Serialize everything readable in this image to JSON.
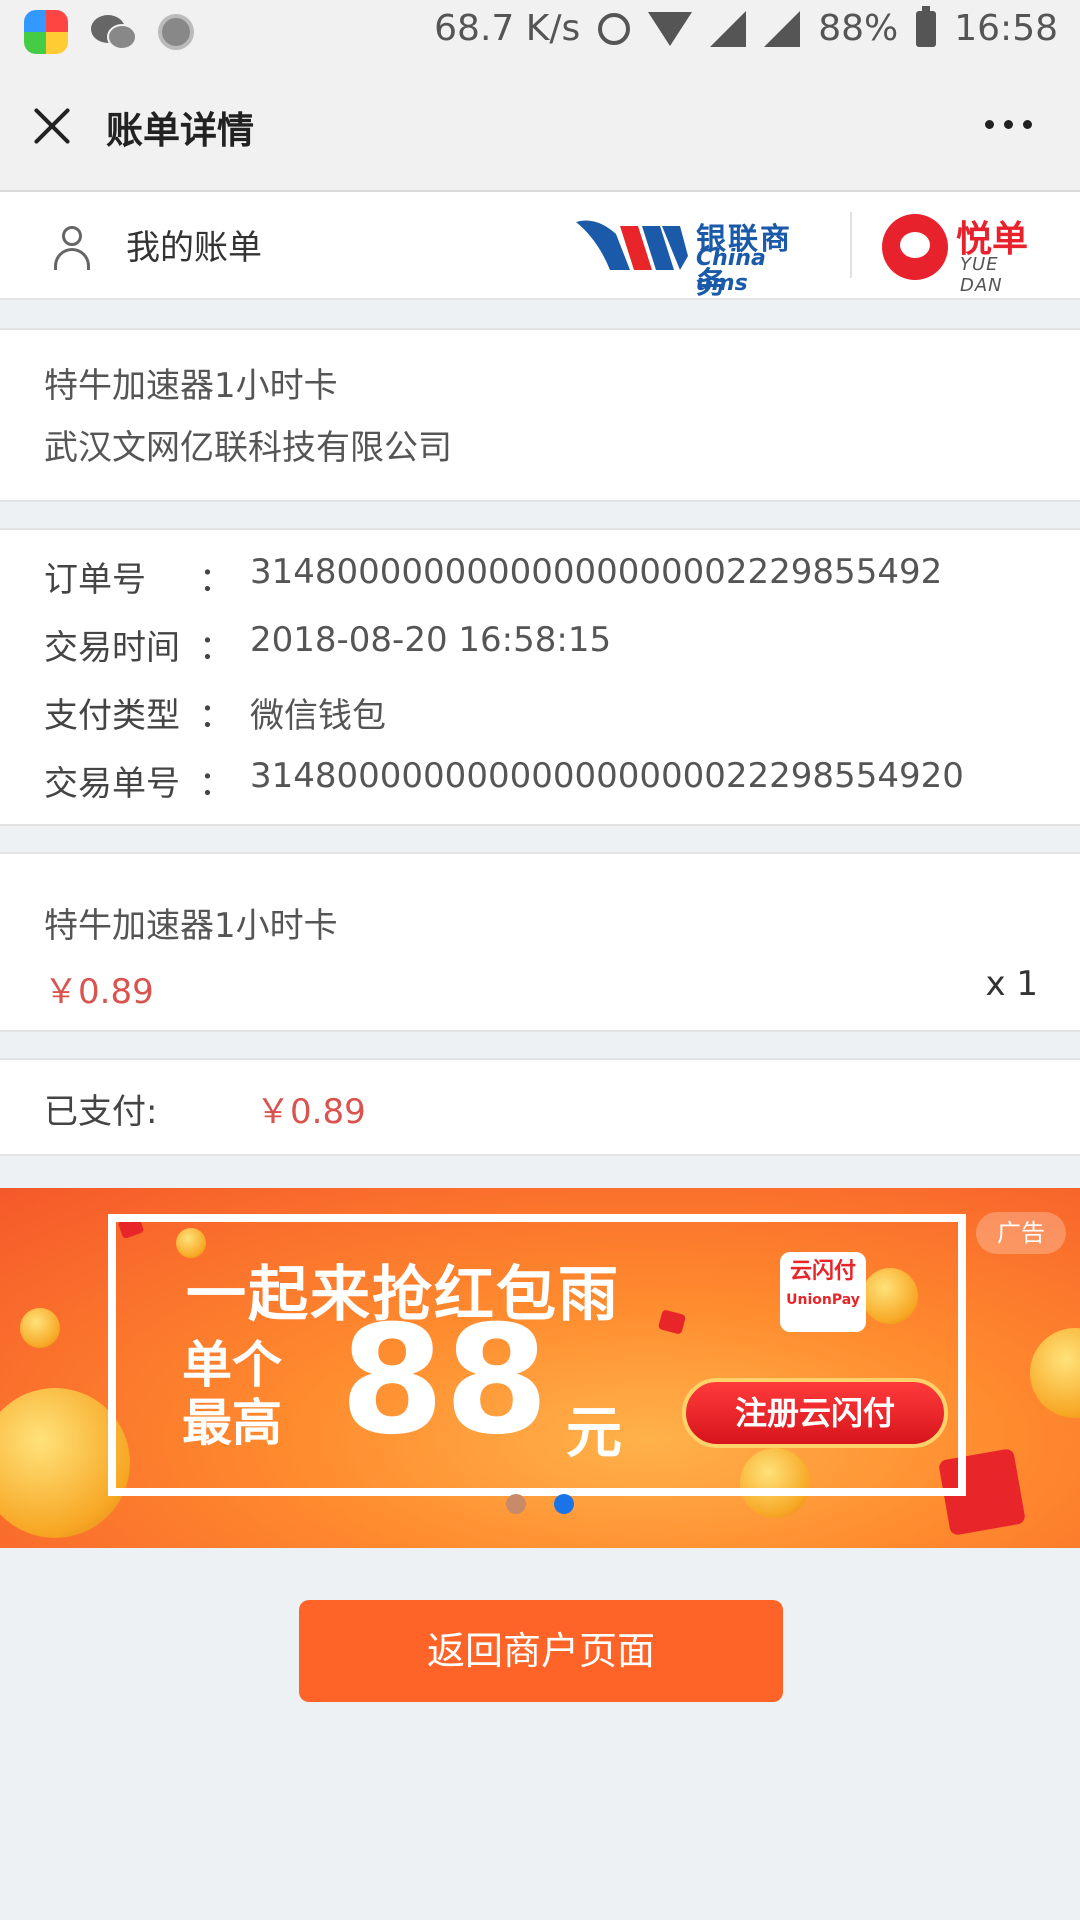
{
  "status_bar": {
    "speed": "68.7 K/s",
    "battery": "88%",
    "time": "16:58"
  },
  "nav": {
    "title": "账单详情"
  },
  "header": {
    "my_bill": "我的账单",
    "chinaums_cn": "银联商务",
    "chinaums_en": "China ums",
    "yuedan_cn": "悦单",
    "yuedan_en": "YUE DAN"
  },
  "merchant": {
    "product": "特牛加速器1小时卡",
    "company": "武汉文网亿联科技有限公司"
  },
  "order": {
    "rows": [
      {
        "label": "订单号",
        "value": "31480000000000000000002229855492"
      },
      {
        "label": "交易时间",
        "value": "2018-08-20 16:58:15"
      },
      {
        "label": "支付类型",
        "value": "微信钱包"
      },
      {
        "label": "交易单号",
        "value": "314800000000000000000022298554920"
      }
    ],
    "colon": "："
  },
  "item": {
    "name": "特牛加速器1小时卡",
    "price": "￥0.89",
    "qty": "x 1"
  },
  "paid": {
    "label": "已支付:",
    "amount": "￥0.89"
  },
  "banner": {
    "ad_tag": "广告",
    "headline": "一起来抢红包雨",
    "sub1": "单个",
    "sub2": "最高",
    "amount": "88",
    "unit": "元",
    "cta": "注册云闪付",
    "app_name": "云闪付",
    "app_sub": "UnionPay",
    "slides": 2,
    "active_slide": 2
  },
  "footer": {
    "return_label": "返回商户页面"
  }
}
